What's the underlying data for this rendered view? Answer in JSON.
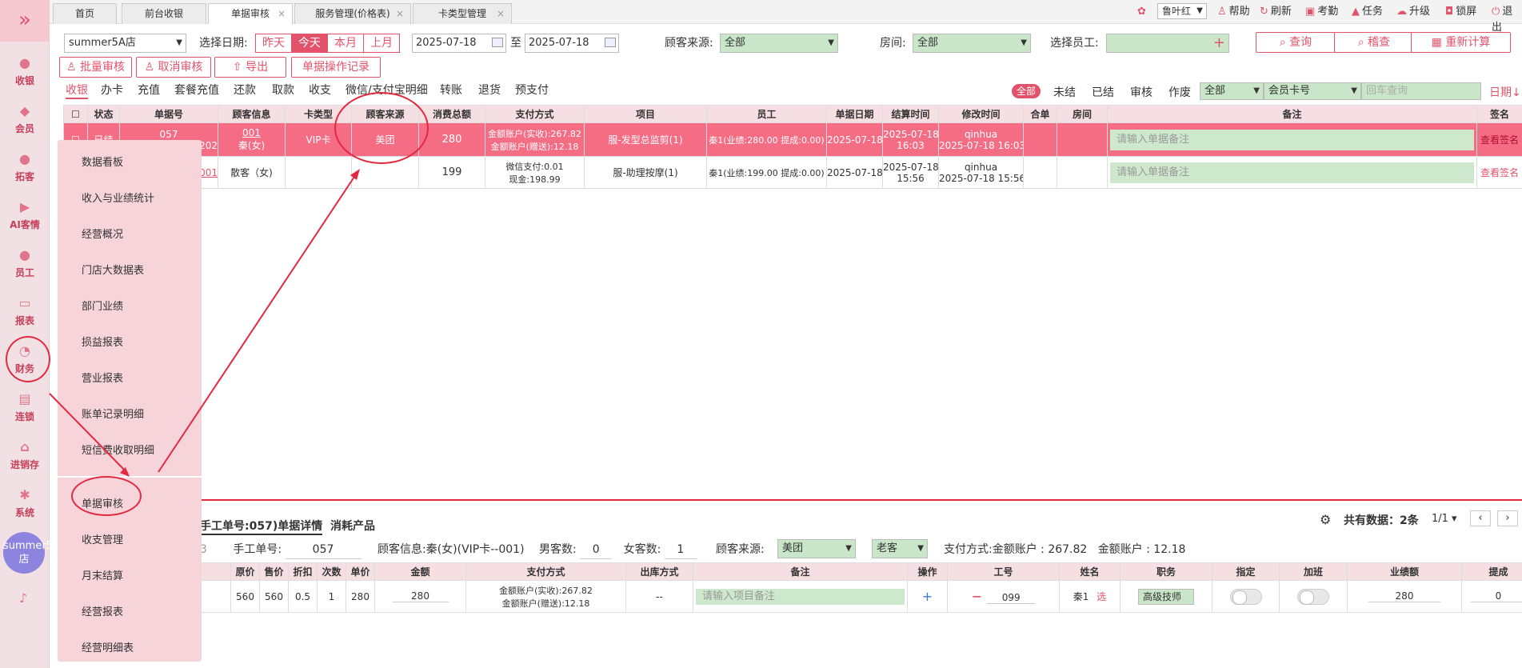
{
  "sidebar": {
    "toggle": "»",
    "items": [
      "收银",
      "会员",
      "拓客",
      "AI客情",
      "员工",
      "报表",
      "财务",
      "连锁",
      "进销存",
      "系统"
    ],
    "store_badge": "summer5A店"
  },
  "tabs": [
    {
      "label": "首页"
    },
    {
      "label": "前台收银"
    },
    {
      "label": "单据审核",
      "close": "×"
    },
    {
      "label": "服务管理(价格表)",
      "close": "×"
    },
    {
      "label": "卡类型管理",
      "close": "×"
    }
  ],
  "topright": {
    "theme_select": "鲁叶红",
    "items": [
      "帮助",
      "刷新",
      "考勤",
      "任务",
      "升级",
      "锁屏",
      "退出"
    ]
  },
  "filters": {
    "store": "summer5A店",
    "date_label": "选择日期:",
    "quick_dates": [
      "昨天",
      "今天",
      "本月",
      "上月"
    ],
    "date_from": "2025-07-18",
    "to": "至",
    "date_to": "2025-07-18",
    "source_label": "顾客来源:",
    "source_value": "全部",
    "room_label": "房间:",
    "room_value": "全部",
    "staff_label": "选择员工:",
    "staff_plus": "+",
    "btn_query": "查询",
    "btn_check": "稽查",
    "btn_recalc": "重新计算"
  },
  "actions": {
    "batch_audit": "批量审核",
    "cancel_audit": "取消审核",
    "export": "导出",
    "log": "单据操作记录"
  },
  "subtabs": [
    "收银",
    "办卡",
    "充值",
    "套餐充值",
    "还款",
    "取款",
    "收支",
    "微信/支付宝明细",
    "转账",
    "退货",
    "预支付"
  ],
  "status_filters": {
    "items": [
      "全部",
      "未结",
      "已结",
      "审核",
      "作废"
    ],
    "select_all": "全部",
    "select_card": "会员卡号",
    "search_placeholder": "回车查询",
    "sort": "日期↓"
  },
  "table": {
    "headers": [
      "状态",
      "单据号",
      "顾客信息",
      "卡类型",
      "顾客来源",
      "消费总额",
      "支付方式",
      "项目",
      "员工",
      "单据日期",
      "结算时间",
      "修改时间",
      "合单",
      "房间",
      "备注",
      "签名"
    ],
    "rows": [
      {
        "status": "已结",
        "no": "057",
        "no2": "202",
        "cust_code": "001",
        "cust": "秦(女)",
        "card": "VIP卡",
        "source": "美团",
        "total": "280",
        "pay1": "金额账户(实收):267.82",
        "pay2": "金额账户(赠送):12.18",
        "item": "服-发型总监剪(1)",
        "staff": "秦1(业绩:280.00 提成:0.00)",
        "date": "2025-07-18",
        "settle1": "2025-07-18",
        "settle2": "16:03",
        "mod1": "qinhua",
        "mod2": "2025-07-18 16:03",
        "note_ph": "请输入单据备注",
        "sign": "查看签名"
      },
      {
        "status": "",
        "no": "",
        "no2": "001",
        "cust_code": "",
        "cust": "散客（女)",
        "card": "",
        "source": "",
        "total": "199",
        "pay1": "微信支付:0.01",
        "pay2": "现金:198.99",
        "item": "服-助理按摩(1)",
        "staff": "秦1(业绩:199.00 提成:0.00)",
        "date": "2025-07-18",
        "settle1": "2025-07-18",
        "settle2": "15:56",
        "mod1": "qinhua",
        "mod2": "2025-07-18 15:56",
        "note_ph": "请输入单据备注",
        "sign": "查看签名"
      }
    ]
  },
  "flyout": [
    "数据看板",
    "收入与业绩统计",
    "经营概况",
    "门店大数据表",
    "部门业绩",
    "损益报表",
    "营业报表",
    "账单记录明细",
    "短信费收取明细",
    "单据审核",
    "收支管理",
    "月末结算",
    "经营报表",
    "经营明细表"
  ],
  "detail": {
    "tab1": "手工单号:057)单据详情",
    "tab2": "消耗产品",
    "total_text": "共有数据：",
    "total_count": "2条",
    "page": "1/1",
    "info": {
      "manual_label": "手工单号:",
      "manual_value": "057",
      "cust_label": "顾客信息:",
      "cust_value": "秦(女)(VIP卡--001)",
      "male_label": "男客数:",
      "male_value": "0",
      "female_label": "女客数:",
      "female_value": "1",
      "source_label": "顾客来源:",
      "source_value": "美团",
      "type_value": "老客",
      "pay_label": "支付方式:",
      "pay1": "金额账户 : 267.82",
      "pay2": "金额账户 : 12.18",
      "stub": "3"
    },
    "headers": [
      "原价",
      "售价",
      "折扣",
      "次数",
      "单价",
      "金额",
      "支付方式",
      "出库方式",
      "备注",
      "操作",
      "工号",
      "姓名",
      "职务",
      "指定",
      "加班",
      "业绩额",
      "提成"
    ],
    "row": {
      "orig": "560",
      "sale": "560",
      "disc": "0.5",
      "times": "1",
      "unit": "280",
      "amount": "280",
      "pay1": "金额账户(实收):267.82",
      "pay2": "金额账户(赠送):12.18",
      "out": "--",
      "note_ph": "请输入项目备注",
      "op_add": "+",
      "op_rm": "−",
      "empno": "099",
      "name": "秦1",
      "pick": "选",
      "role": "高级技师",
      "perf": "280",
      "commission": "0"
    }
  },
  "colors": {
    "accent": "#e2536b",
    "highlight_row": "#f56d84",
    "green_field": "#c9e6c9",
    "annotation": "#e2293f"
  }
}
